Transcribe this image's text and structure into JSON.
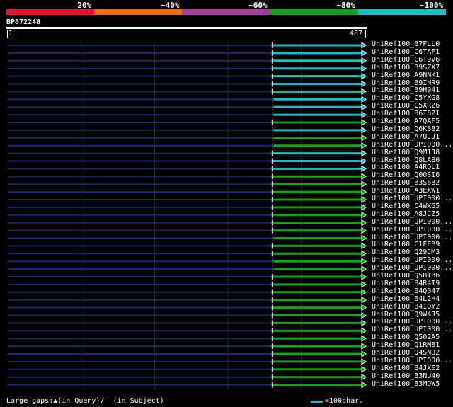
{
  "legend": {
    "labels": [
      "20%",
      "~40%",
      "~60%",
      "~80%",
      "~100%"
    ],
    "colors": [
      "#e8132e",
      "#e86e1a",
      "#a53ca0",
      "#17a01e",
      "#1fbcc8"
    ]
  },
  "query": {
    "name": "BP072248",
    "start_label": "1",
    "end_label": "487"
  },
  "footer": {
    "gaps_text": "Large gaps:▲(in Query)/– (in Subject)",
    "scale_text": "=100char.",
    "scale_color": "#1fbcc8"
  },
  "chart_data": {
    "type": "alignment",
    "query_length": 487,
    "category_colors": {
      "cyan": "#1fbcc8",
      "green": "#17a01e"
    },
    "hits": [
      {
        "name": "UniRef100_B7FLL0",
        "start": 360,
        "end": 487,
        "color": "cyan"
      },
      {
        "name": "UniRef100_C6TAF1",
        "start": 360,
        "end": 487,
        "color": "cyan"
      },
      {
        "name": "UniRef100_C6T9V6",
        "start": 360,
        "end": 487,
        "color": "cyan"
      },
      {
        "name": "UniRef100_B9SZX7",
        "start": 360,
        "end": 487,
        "color": "cyan"
      },
      {
        "name": "UniRef100_A9NNK1",
        "start": 360,
        "end": 487,
        "color": "cyan"
      },
      {
        "name": "UniRef100_B9IHR9",
        "start": 360,
        "end": 487,
        "color": "cyan"
      },
      {
        "name": "UniRef100_B9H941",
        "start": 360,
        "end": 487,
        "color": "cyan"
      },
      {
        "name": "UniRef100_C5YXG8",
        "start": 361,
        "end": 487,
        "color": "cyan"
      },
      {
        "name": "UniRef100_C5XRZ6",
        "start": 361,
        "end": 487,
        "color": "cyan"
      },
      {
        "name": "UniRef100_B6T8Z1",
        "start": 361,
        "end": 487,
        "color": "cyan"
      },
      {
        "name": "UniRef100_A7QAF5",
        "start": 360,
        "end": 487,
        "color": "green"
      },
      {
        "name": "UniRef100_Q6K882",
        "start": 361,
        "end": 487,
        "color": "cyan"
      },
      {
        "name": "UniRef100_A7QJJ1",
        "start": 361,
        "end": 487,
        "color": "green"
      },
      {
        "name": "UniRef100_UPI000...",
        "start": 361,
        "end": 487,
        "color": "green"
      },
      {
        "name": "UniRef100_Q9M1J8",
        "start": 360,
        "end": 487,
        "color": "cyan"
      },
      {
        "name": "UniRef100_Q8LA80",
        "start": 360,
        "end": 487,
        "color": "cyan"
      },
      {
        "name": "UniRef100_A4RQL1",
        "start": 360,
        "end": 487,
        "color": "cyan"
      },
      {
        "name": "UniRef100_Q00SI6",
        "start": 360,
        "end": 487,
        "color": "green"
      },
      {
        "name": "UniRef100_B3S6B2",
        "start": 360,
        "end": 487,
        "color": "green"
      },
      {
        "name": "UniRef100_A3EXW1",
        "start": 360,
        "end": 487,
        "color": "green"
      },
      {
        "name": "UniRef100_UPI000...",
        "start": 360,
        "end": 487,
        "color": "green"
      },
      {
        "name": "UniRef100_C4WXG5",
        "start": 360,
        "end": 487,
        "color": "green"
      },
      {
        "name": "UniRef100_A8JCZ5",
        "start": 360,
        "end": 487,
        "color": "green"
      },
      {
        "name": "UniRef100_UPI000...",
        "start": 360,
        "end": 487,
        "color": "green"
      },
      {
        "name": "UniRef100_UPI000...",
        "start": 360,
        "end": 487,
        "color": "green"
      },
      {
        "name": "UniRef100_UPI000...",
        "start": 361,
        "end": 487,
        "color": "green"
      },
      {
        "name": "UniRef100_C1FEB9",
        "start": 360,
        "end": 487,
        "color": "green"
      },
      {
        "name": "UniRef100_Q29JM3",
        "start": 360,
        "end": 487,
        "color": "green"
      },
      {
        "name": "UniRef100_UPI000...",
        "start": 361,
        "end": 487,
        "color": "green"
      },
      {
        "name": "UniRef100_UPI000...",
        "start": 361,
        "end": 487,
        "color": "green"
      },
      {
        "name": "UniRef100_Q5BIB6",
        "start": 360,
        "end": 487,
        "color": "green"
      },
      {
        "name": "UniRef100_B4R4I9",
        "start": 360,
        "end": 487,
        "color": "green"
      },
      {
        "name": "UniRef100_B4Q047",
        "start": 360,
        "end": 487,
        "color": "green"
      },
      {
        "name": "UniRef100_B4L2H4",
        "start": 360,
        "end": 487,
        "color": "green"
      },
      {
        "name": "UniRef100_B4IOY2",
        "start": 360,
        "end": 487,
        "color": "green"
      },
      {
        "name": "UniRef100_Q9W4J5",
        "start": 360,
        "end": 487,
        "color": "green"
      },
      {
        "name": "UniRef100_UPI000...",
        "start": 360,
        "end": 487,
        "color": "green"
      },
      {
        "name": "UniRef100_UPI000...",
        "start": 360,
        "end": 487,
        "color": "green"
      },
      {
        "name": "UniRef100_Q502A5",
        "start": 360,
        "end": 487,
        "color": "green"
      },
      {
        "name": "UniRef100_Q1RM81",
        "start": 360,
        "end": 487,
        "color": "green"
      },
      {
        "name": "UniRef100_Q4SND2",
        "start": 360,
        "end": 487,
        "color": "green"
      },
      {
        "name": "UniRef100_UPI000...",
        "start": 360,
        "end": 487,
        "color": "green"
      },
      {
        "name": "UniRef100_B4JXE2",
        "start": 360,
        "end": 487,
        "color": "green"
      },
      {
        "name": "UniRef100_B3NU40",
        "start": 360,
        "end": 487,
        "color": "green"
      },
      {
        "name": "UniRef100_B3MQW5",
        "start": 360,
        "end": 487,
        "color": "green"
      }
    ]
  }
}
